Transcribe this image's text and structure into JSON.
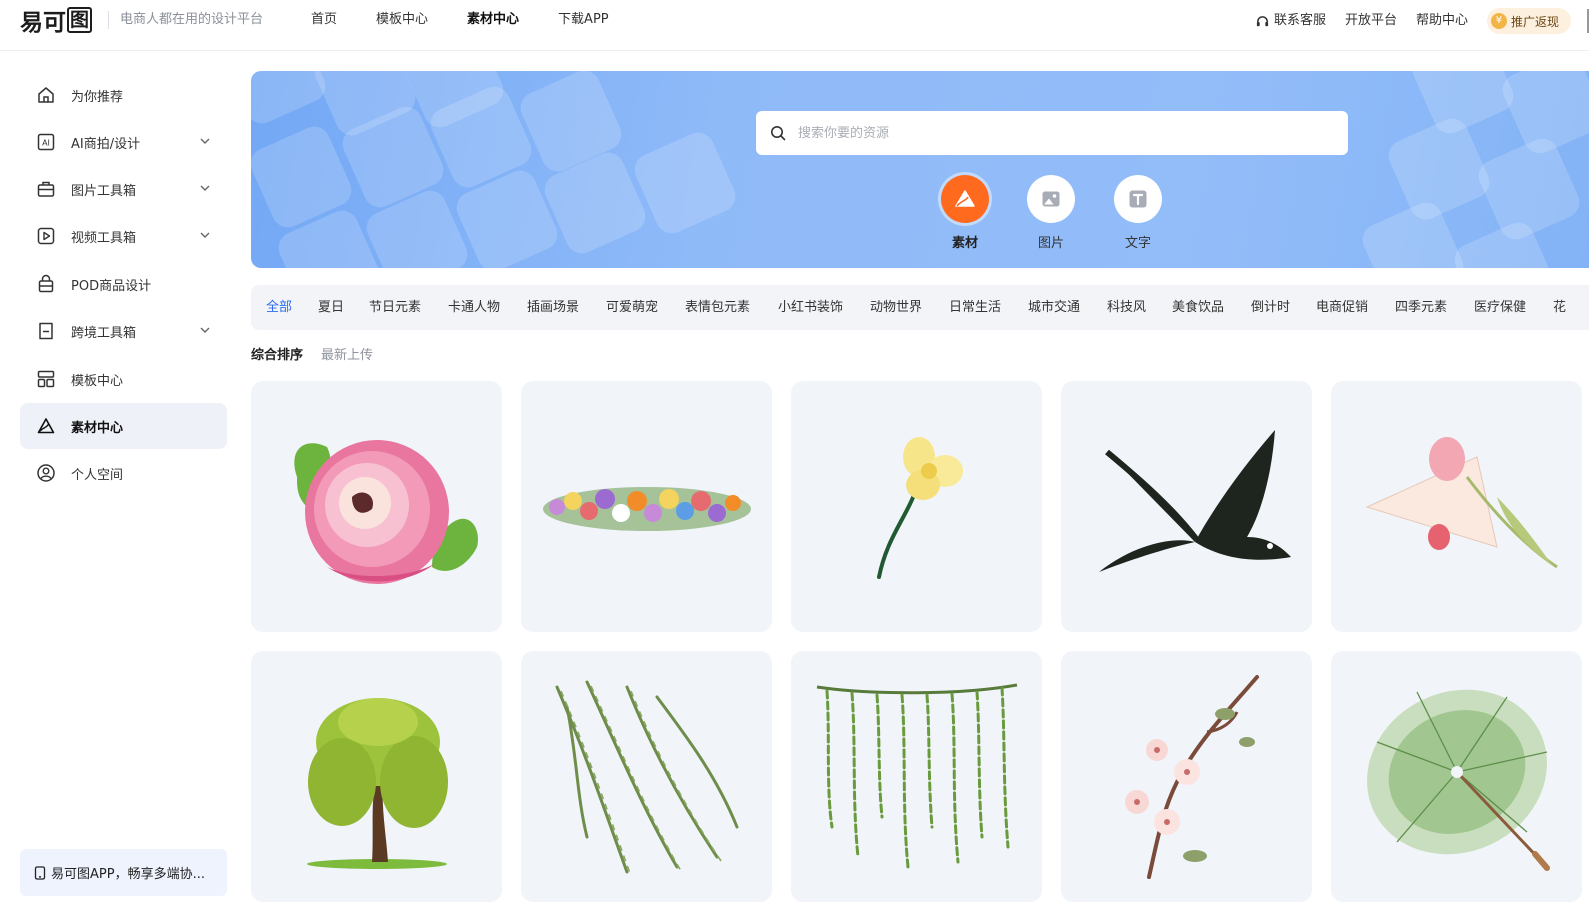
{
  "brand": {
    "logo_text_a": "易可",
    "logo_text_b": "图",
    "slogan": "电商人都在用的设计平台"
  },
  "topnav": [
    {
      "label": "首页",
      "active": false
    },
    {
      "label": "模板中心",
      "active": false
    },
    {
      "label": "素材中心",
      "active": true
    },
    {
      "label": "下载APP",
      "active": false
    }
  ],
  "topright": {
    "service": "联系客服",
    "open_platform": "开放平台",
    "help": "帮助中心",
    "promo": "推广返现"
  },
  "sidebar": {
    "items": [
      {
        "label": "为你推荐",
        "icon": "home-icon",
        "expandable": false,
        "active": false
      },
      {
        "label": "AI商拍/设计",
        "icon": "ai-icon",
        "expandable": true,
        "active": false
      },
      {
        "label": "图片工具箱",
        "icon": "toolbox-icon",
        "expandable": true,
        "active": false
      },
      {
        "label": "视频工具箱",
        "icon": "video-icon",
        "expandable": true,
        "active": false
      },
      {
        "label": "POD商品设计",
        "icon": "bag-icon",
        "expandable": false,
        "active": false
      },
      {
        "label": "跨境工具箱",
        "icon": "crossborder-icon",
        "expandable": true,
        "active": false
      },
      {
        "label": "模板中心",
        "icon": "template-icon",
        "expandable": false,
        "active": false
      },
      {
        "label": "素材中心",
        "icon": "material-icon",
        "expandable": false,
        "active": true
      },
      {
        "label": "个人空间",
        "icon": "user-icon",
        "expandable": false,
        "active": false
      }
    ],
    "app_promo": "易可图APP，畅享多端协..."
  },
  "search": {
    "placeholder": "搜索你要的资源",
    "value": ""
  },
  "type_buttons": [
    {
      "label": "素材",
      "icon": "material-icon",
      "active": true
    },
    {
      "label": "图片",
      "icon": "image-icon",
      "active": false
    },
    {
      "label": "文字",
      "icon": "text-icon",
      "active": false
    }
  ],
  "categories": [
    "全部",
    "夏日",
    "节日元素",
    "卡通人物",
    "插画场景",
    "可爱萌宠",
    "表情包元素",
    "小红书装饰",
    "动物世界",
    "日常生活",
    "城市交通",
    "科技风",
    "美食饮品",
    "倒计时",
    "电商促销",
    "四季元素",
    "医疗保健",
    "花"
  ],
  "active_category": "全部",
  "sort": {
    "options": [
      "综合排序",
      "最新上传"
    ],
    "active": "综合排序"
  },
  "materials": [
    {
      "name": "peony-flower"
    },
    {
      "name": "flower-garland"
    },
    {
      "name": "yellow-flower"
    },
    {
      "name": "swallow-bird"
    },
    {
      "name": "tulip-envelope"
    },
    {
      "name": "willow-tree"
    },
    {
      "name": "willow-branches"
    },
    {
      "name": "hanging-willow"
    },
    {
      "name": "cherry-blossom-branch"
    },
    {
      "name": "green-umbrella"
    }
  ],
  "colors": {
    "accent": "#2d6cf0",
    "orange": "#ff6a1e",
    "banner": "#8fbaf8",
    "card_bg": "#f1f4f9",
    "sidebar_active": "#eef1f7"
  }
}
